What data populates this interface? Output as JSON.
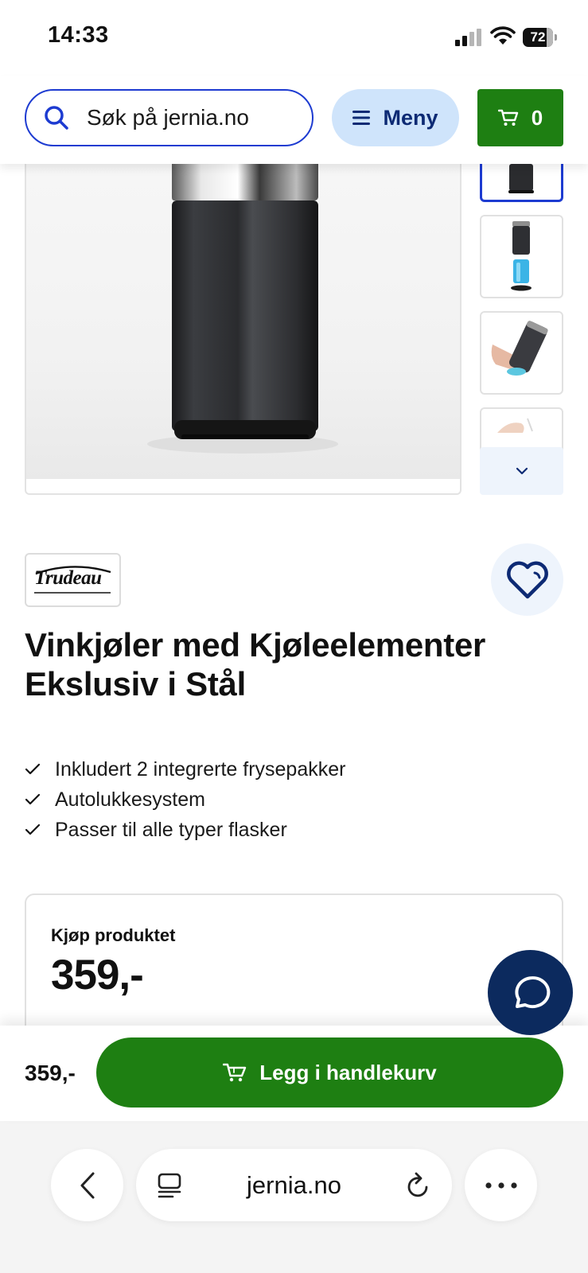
{
  "status_bar": {
    "time": "14:33",
    "battery": "72"
  },
  "header": {
    "search_placeholder": "Søk på jernia.no",
    "menu_label": "Meny",
    "cart_count": "0"
  },
  "product": {
    "brand": "Trudeau",
    "title_line1": "Vinkjøler med Kjøleelementer",
    "title_line2": "Ekslusiv i Stål",
    "features": [
      "Inkludert 2 integrerte frysepakker",
      "Autolukkesystem",
      "Passer til alle typer flasker"
    ]
  },
  "buy": {
    "label": "Kjøp produktet",
    "price": "359,-"
  },
  "sticky": {
    "price": "359,-",
    "add_to_cart_label": "Legg i handlekurv"
  },
  "browser": {
    "url": "jernia.no"
  },
  "colors": {
    "brand_blue": "#1d3bd1",
    "menu_bg": "#cfe4fb",
    "cta_green": "#1e7f12",
    "chat_navy": "#0c2a5e"
  },
  "icons": [
    "search-icon",
    "menu-icon",
    "cart-icon",
    "chevron-down-icon",
    "heart-icon",
    "check-icon",
    "chat-icon",
    "back-icon",
    "tabs-icon",
    "reload-icon",
    "more-icon"
  ]
}
